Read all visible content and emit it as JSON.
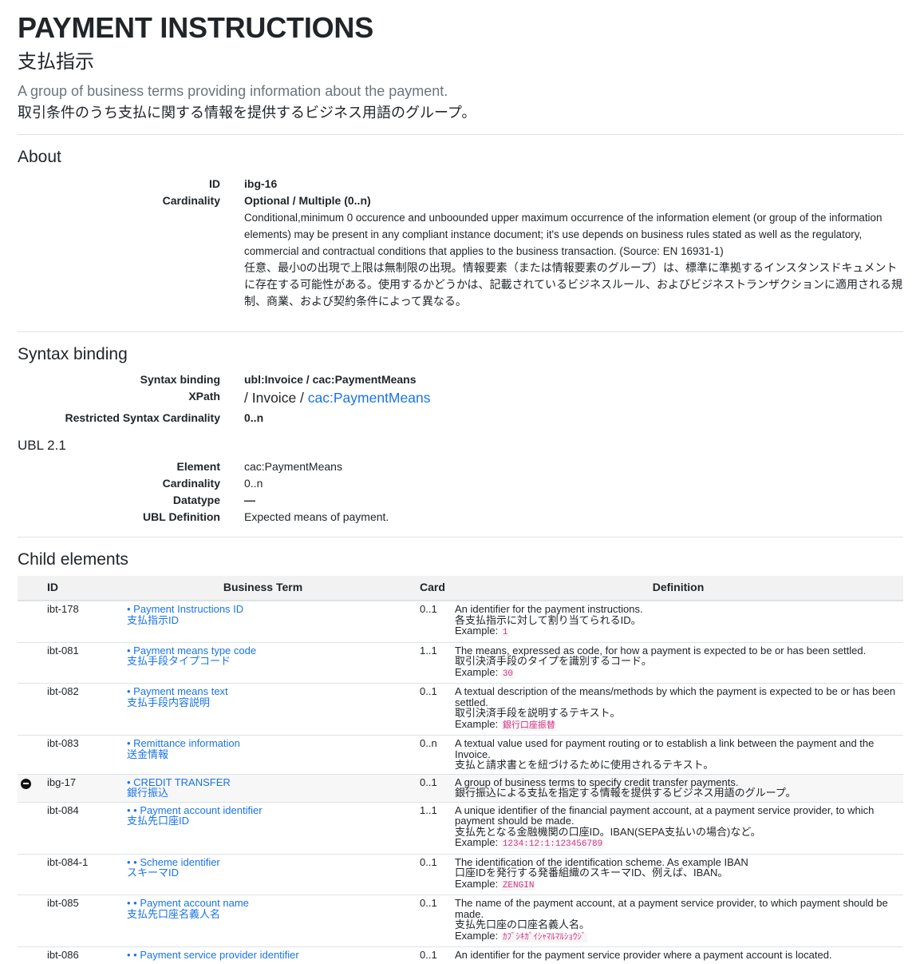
{
  "header": {
    "title": "PAYMENT INSTRUCTIONS",
    "title_ja": "支払指示",
    "desc_en": "A group of business terms providing information about the payment.",
    "desc_ja": "取引条件のうち支払に関する情報を提供するビジネス用語のグループ。"
  },
  "about": {
    "heading": "About",
    "id_label": "ID",
    "id_value": "ibg-16",
    "card_label": "Cardinality",
    "card_value": "Optional / Multiple (0..n)",
    "card_desc_en": "Conditional,minimum 0 occurence and unboounded upper maximum occurrence of the information element (or group of the information elements) may be present in any compliant instance document; it's use depends on business rules stated as well as the regulatory, commercial and contractual conditions that applies to the business transaction. (Source: EN 16931-1)",
    "card_desc_ja": "任意、最小0の出現で上限は無制限の出現。情報要素（または情報要素のグループ）は、標準に準拠するインスタンスドキュメントに存在する可能性がある。使用するかどうかは、記載されているビジネスルール、およびビジネストランザクションに適用される規制、商業、および契約条件によって異なる。"
  },
  "syntax": {
    "heading": "Syntax binding",
    "binding_label": "Syntax binding",
    "binding_value": "ubl:Invoice / cac:PaymentMeans",
    "xpath_label": "XPath",
    "xpath_prefix": "/ Invoice /",
    "xpath_link": "cac:PaymentMeans",
    "restricted_label": "Restricted Syntax Cardinality",
    "restricted_value": "0..n"
  },
  "ubl": {
    "heading": "UBL 2.1",
    "element_label": "Element",
    "element_value": "cac:PaymentMeans",
    "card_label": "Cardinality",
    "card_value": "0..n",
    "datatype_label": "Datatype",
    "datatype_value": "—",
    "def_label": "UBL Definition",
    "def_value": "Expected means of payment."
  },
  "children": {
    "heading": "Child elements",
    "columns": [
      "ID",
      "Business Term",
      "Card",
      "Definition"
    ],
    "rows": [
      {
        "id": "ibt-178",
        "term": "• Payment Instructions ID",
        "term_ja": "支払指示ID",
        "card": "0..1",
        "def_en": "An identifier for the payment instructions.",
        "def_ja": "各支払指示に対して割り当てられるID。",
        "example_label": "Example:",
        "example": "1",
        "group": false
      },
      {
        "id": "ibt-081",
        "term": "• Payment means type code",
        "term_ja": "支払手段タイプコード",
        "card": "1..1",
        "def_en": "The means, expressed as code, for how a payment is expected to be or has been settled.",
        "def_ja": "取引決済手段のタイプを識別するコード。",
        "example_label": "Example:",
        "example": "30",
        "group": false
      },
      {
        "id": "ibt-082",
        "term": "• Payment means text",
        "term_ja": "支払手段内容説明",
        "card": "0..1",
        "def_en": "A textual description of the means/methods by which the payment is expected to be or has been settled.",
        "def_ja": "取引決済手段を説明するテキスト。",
        "example_label": "Example:",
        "example": "銀行口座振替",
        "group": false
      },
      {
        "id": "ibt-083",
        "term": "• Remittance information",
        "term_ja": "送金情報",
        "card": "0..n",
        "def_en": "A textual value used for payment routing or to establish a link between the payment and the Invoice.",
        "def_ja": "支払と請求書とを紐づけるために使用されるテキスト。",
        "example_label": "",
        "example": "",
        "group": false
      },
      {
        "id": "ibg-17",
        "term": "• CREDIT TRANSFER",
        "term_ja": "銀行振込",
        "card": "0..1",
        "def_en": "A group of business terms to specify credit transfer payments.",
        "def_ja": "銀行振込による支払を指定する情報を提供するビジネス用語のグループ。",
        "example_label": "",
        "example": "",
        "group": true
      },
      {
        "id": "ibt-084",
        "term": "• • Payment account identifier",
        "term_ja": "支払先口座ID",
        "card": "1..1",
        "def_en": "A unique identifier of the financial payment account, at a payment service provider, to which payment should be made.",
        "def_ja": "支払先となる金融機関の口座ID。IBAN(SEPA支払いの場合)など。",
        "example_label": "Example:",
        "example": "1234:12:1:123456789",
        "group": false
      },
      {
        "id": "ibt-084-1",
        "term": "• • Scheme identifier",
        "term_ja": "スキーマID",
        "card": "0..1",
        "def_en": "The identification of the identification scheme. As example IBAN",
        "def_ja": "口座IDを発行する発番組織のスキーマID、例えば、IBAN。",
        "example_label": "Example:",
        "example": "ZENGIN",
        "group": false
      },
      {
        "id": "ibt-085",
        "term": "• • Payment account name",
        "term_ja": "支払先口座名義人名",
        "card": "0..1",
        "def_en": "The name of the payment account, at a payment service provider, to which payment should be made.",
        "def_ja": "支払先口座の口座名義人名。",
        "example_label": "Example:",
        "example": "ｶﾌﾞｼｷｶﾞｲｼｬﾏﾙﾏﾙｼｮｳｼﾞ",
        "group": false
      },
      {
        "id": "ibt-086",
        "term": "• • Payment service provider identifier",
        "term_ja": "",
        "card": "0..1",
        "def_en": "An identifier for the payment service provider where a payment account is located.",
        "def_ja": "",
        "example_label": "",
        "example": "",
        "group": false
      }
    ]
  }
}
